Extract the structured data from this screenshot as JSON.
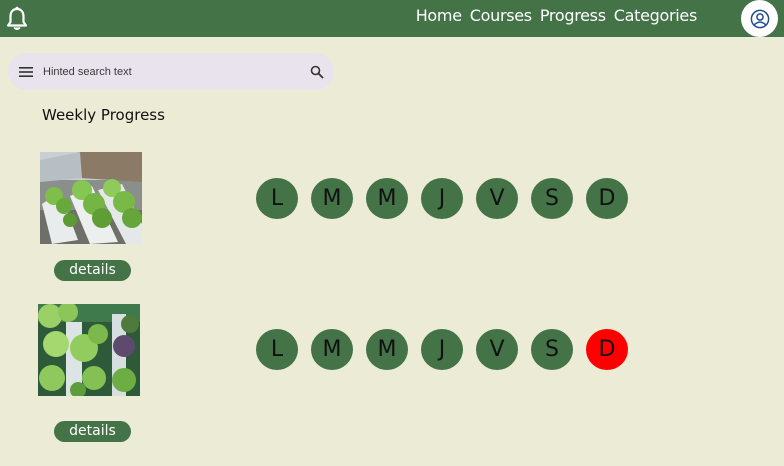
{
  "topbar": {
    "nav": [
      {
        "label": "Home"
      },
      {
        "label": "Courses"
      },
      {
        "label": "Progress"
      },
      {
        "label": "Categories"
      }
    ],
    "icons": {
      "notifications": "bell-icon",
      "account": "account-circle-icon"
    },
    "color": "#437346"
  },
  "search": {
    "placeholder": "Hinted search text",
    "value": "",
    "icons": {
      "menu": "menu-icon",
      "search": "search-icon"
    }
  },
  "section": {
    "title": "Weekly Progress"
  },
  "entries": [
    {
      "image": "hydroponic-lettuce-rows-photo",
      "details_label": "details",
      "days": [
        {
          "letter": "L",
          "status": "done"
        },
        {
          "letter": "M",
          "status": "done"
        },
        {
          "letter": "M",
          "status": "done"
        },
        {
          "letter": "J",
          "status": "done"
        },
        {
          "letter": "V",
          "status": "done"
        },
        {
          "letter": "S",
          "status": "done"
        },
        {
          "letter": "D",
          "status": "done"
        }
      ]
    },
    {
      "image": "vertical-hydroponic-tower-photo",
      "details_label": "details",
      "days": [
        {
          "letter": "L",
          "status": "done"
        },
        {
          "letter": "M",
          "status": "done"
        },
        {
          "letter": "M",
          "status": "done"
        },
        {
          "letter": "J",
          "status": "done"
        },
        {
          "letter": "V",
          "status": "done"
        },
        {
          "letter": "S",
          "status": "done"
        },
        {
          "letter": "D",
          "status": "missed"
        }
      ]
    }
  ],
  "colors": {
    "done": "#437346",
    "missed": "#FF0000",
    "background": "#ECEBD5"
  }
}
